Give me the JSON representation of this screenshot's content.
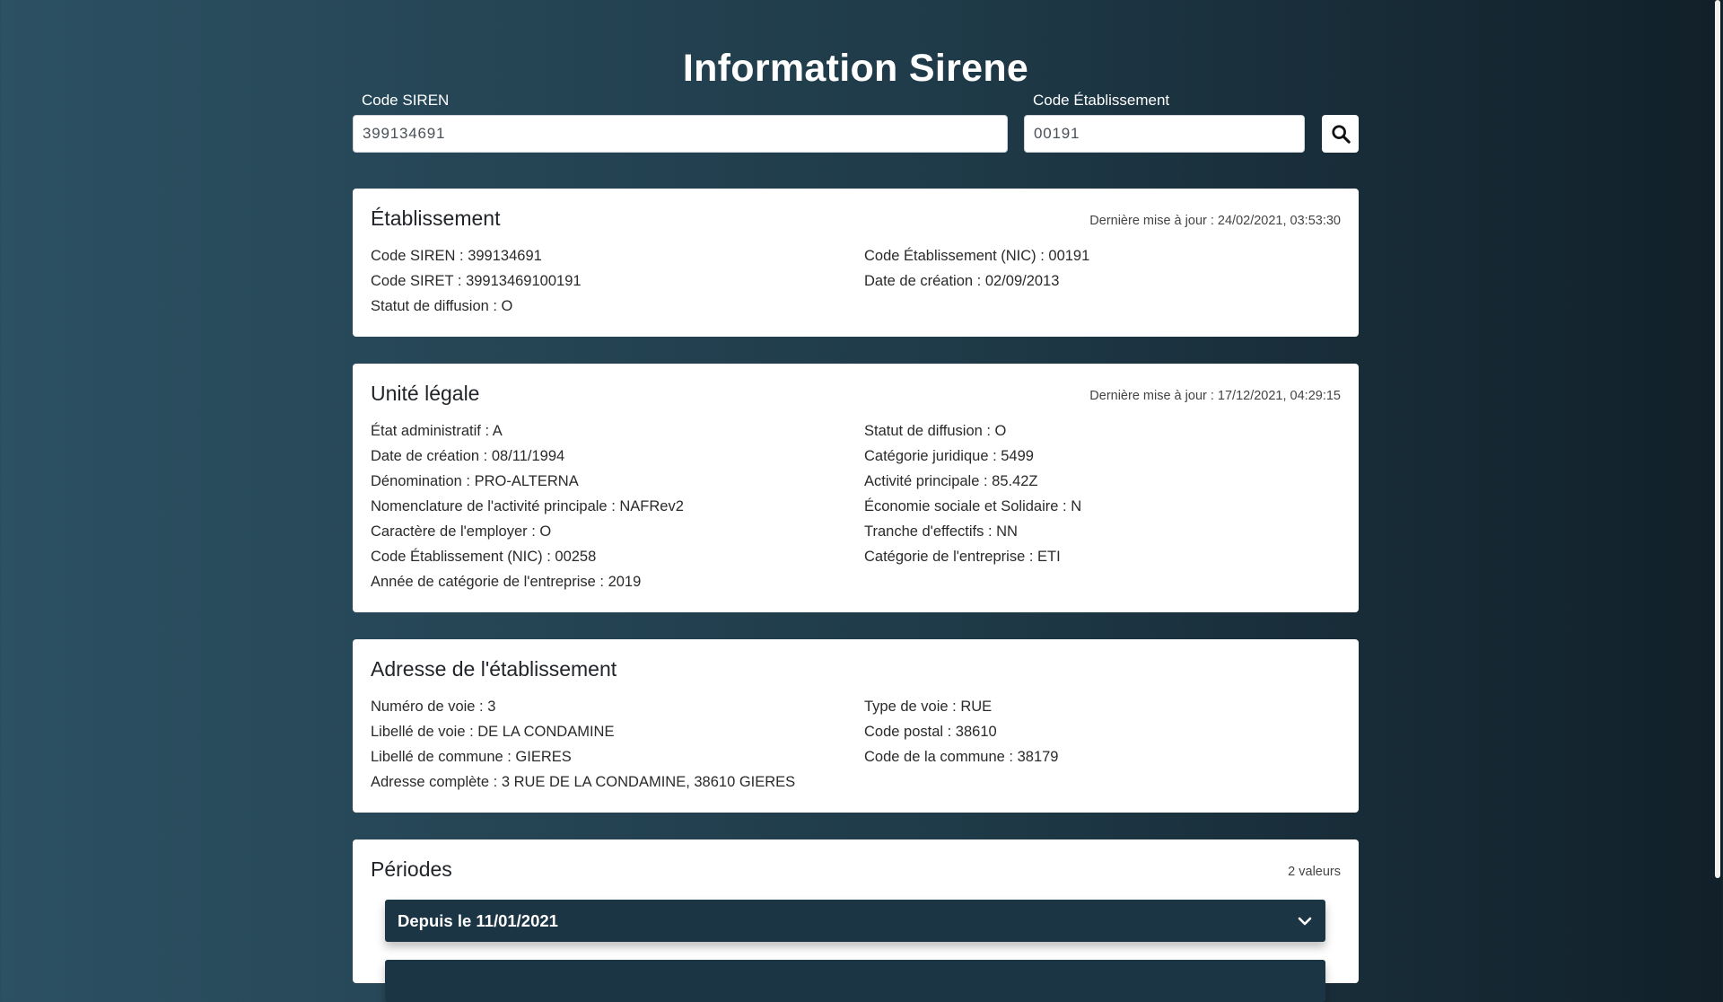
{
  "page": {
    "title": "Information Sirene"
  },
  "search": {
    "siren_label": "Code SIREN",
    "siren_value": "399134691",
    "etab_label": "Code Établissement",
    "etab_value": "00191",
    "button_icon": "search-icon"
  },
  "etablissement": {
    "title": "Établissement",
    "update": "Dernière mise à jour : 24/02/2021, 03:53:30",
    "left": [
      "Code SIREN : 399134691",
      "Code SIRET : 39913469100191",
      "Statut de diffusion : O"
    ],
    "right": [
      "Code Établissement (NIC) : 00191",
      "Date de création : 02/09/2013"
    ]
  },
  "unite_legale": {
    "title": "Unité légale",
    "update": "Dernière mise à jour : 17/12/2021, 04:29:15",
    "left": [
      "État administratif : A",
      "Date de création : 08/11/1994",
      "Dénomination : PRO-ALTERNA",
      "Nomenclature de l'activité principale : NAFRev2",
      "Caractère de l'employer : O",
      "Code Établissement (NIC) : 00258",
      "Année de catégorie de l'entreprise : 2019"
    ],
    "right": [
      "Statut de diffusion : O",
      "Catégorie juridique : 5499",
      "Activité principale : 85.42Z",
      "Économie sociale et Solidaire : N",
      "Tranche d'effectifs : NN",
      "Catégorie de l'entreprise : ETI"
    ]
  },
  "adresse": {
    "title": "Adresse de l'établissement",
    "left": [
      "Numéro de voie : 3",
      "Libellé de voie : DE LA CONDAMINE",
      "Libellé de commune : GIERES",
      "Adresse complète : 3 RUE DE LA CONDAMINE, 38610 GIERES"
    ],
    "right": [
      "Type de voie : RUE",
      "Code postal : 38610",
      "Code de la commune : 38179"
    ]
  },
  "periodes": {
    "title": "Périodes",
    "count": "2 valeurs",
    "items": [
      {
        "label": "Depuis le 11/01/2021",
        "icon": "chevron-down-icon"
      },
      {
        "label": "",
        "icon": "chevron-down-icon"
      }
    ]
  },
  "colors": {
    "accordion_bg": "#1b3544",
    "page_gradient_start": "#2c5163",
    "page_gradient_end": "#112029"
  }
}
